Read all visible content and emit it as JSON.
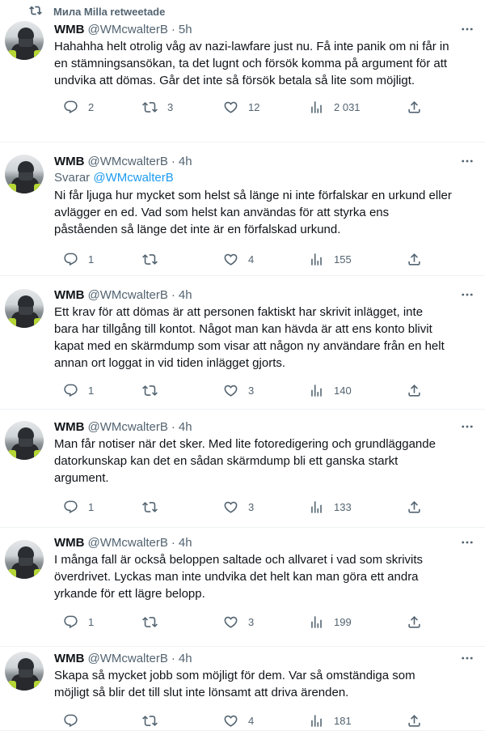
{
  "tweets": [
    {
      "social_context": "Мила Milla retweetade",
      "name": "WMB",
      "handle": "@WMcwalterB",
      "time": "5h",
      "reply_to": null,
      "lines": [
        "Hahahha helt otrolig våg av nazi-lawfare just nu. Få inte panik om ni får in",
        "en stämningsansökan, ta det lugnt och försök komma på argument för att",
        "undvika att dömas. Går det inte så försök betala så lite som möjligt."
      ],
      "replies": "2",
      "retweets": "3",
      "likes": "12",
      "views": "2 031"
    },
    {
      "social_context": null,
      "name": "WMB",
      "handle": "@WMcwalterB",
      "time": "4h",
      "reply_to": {
        "prefix": "Svarar",
        "handle": "@WMcwalterB"
      },
      "lines": [
        "Ni får ljuga hur mycket som helst så länge ni inte förfalskar en urkund eller",
        "avlägger en ed. Vad som helst kan användas för att styrka ens",
        "påståenden så länge det inte är en förfalskad urkund."
      ],
      "replies": "1",
      "retweets": "",
      "likes": "4",
      "views": "155"
    },
    {
      "social_context": null,
      "name": "WMB",
      "handle": "@WMcwalterB",
      "time": "4h",
      "reply_to": null,
      "lines": [
        "Ett krav för att dömas är att personen faktiskt har skrivit inlägget, inte",
        "bara har tillgång till kontot. Något man kan hävda är att ens konto blivit",
        "kapat med en skärmdump som visar att någon ny användare från en helt",
        "annan ort loggat in vid tiden inlägget gjorts."
      ],
      "replies": "1",
      "retweets": "",
      "likes": "3",
      "views": "140"
    },
    {
      "social_context": null,
      "name": "WMB",
      "handle": "@WMcwalterB",
      "time": "4h",
      "reply_to": null,
      "lines": [
        "Man får notiser när det sker. Med lite fotoredigering och grundläggande",
        "datorkunskap kan det en sådan skärmdump bli ett ganska starkt",
        "argument."
      ],
      "replies": "1",
      "retweets": "",
      "likes": "3",
      "views": "133"
    },
    {
      "social_context": null,
      "name": "WMB",
      "handle": "@WMcwalterB",
      "time": "4h",
      "reply_to": null,
      "lines": [
        "I många fall är också beloppen saltade och allvaret i vad som skrivits",
        "överdrivet. Lyckas man inte undvika det helt kan man göra ett andra",
        "yrkande för ett lägre belopp."
      ],
      "replies": "1",
      "retweets": "",
      "likes": "3",
      "views": "199"
    },
    {
      "social_context": null,
      "name": "WMB",
      "handle": "@WMcwalterB",
      "time": "4h",
      "reply_to": null,
      "lines": [
        "Skapa så mycket jobb som möjligt för dem. Var så omständiga som",
        "möjligt så blir det till slut inte lönsamt att driva ärenden."
      ],
      "replies": "",
      "retweets": "",
      "likes": "4",
      "views": "181"
    }
  ]
}
